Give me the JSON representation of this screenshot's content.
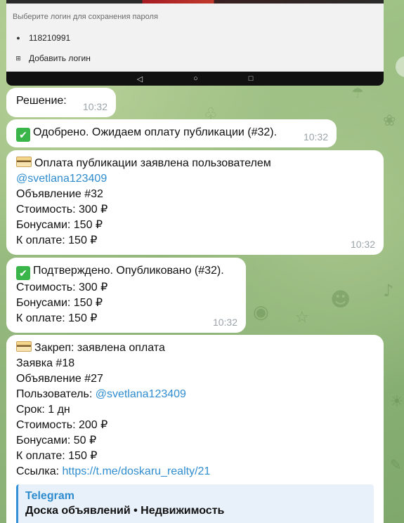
{
  "screenshot": {
    "hint": "Выберите логин для сохранения пароля",
    "login_value": "118210991",
    "add_login": "Добавить логин",
    "nav_back": "◁",
    "nav_home": "○",
    "nav_recent": "□"
  },
  "messages": [
    {
      "lines": [
        "Решение:"
      ],
      "time": "10:32"
    },
    {
      "emoji": "✔",
      "lines": [
        "Одобрено. Ожидаем оплату публикации (#32)."
      ],
      "time": "10:32"
    },
    {
      "lines": [
        "Оплата публикации заявлена пользователем",
        "@svetlana123409",
        "Объявление #32",
        "Стоимость: 300 ₽",
        "Бонусами: 150 ₽",
        "К оплате: 150 ₽"
      ],
      "time": "10:32"
    },
    {
      "emoji": "✔",
      "lines": [
        "Подтверждено. Опубликовано (#32).",
        "Стоимость: 300 ₽",
        "Бонусами: 150 ₽",
        "К оплате: 150 ₽"
      ],
      "time": "10:32"
    },
    {
      "lines": [
        "Закреп: заявлена оплата",
        "Заявка #18",
        "Объявление #27",
        "Пользователь: ",
        "@svetlana123409",
        "Срок: 1 дн",
        "Стоимость: 200 ₽",
        "Бонусами: 50 ₽",
        "К оплате: 150 ₽",
        "Ссылка: ",
        "https://t.me/doskaru_realty/21"
      ],
      "preview": {
        "site": "Telegram",
        "title": "Доска объявлений • Недвижимость"
      }
    }
  ],
  "colors": {
    "link": "#2f8ccf",
    "bubble": "#ffffff",
    "time": "#9aa3a8"
  }
}
